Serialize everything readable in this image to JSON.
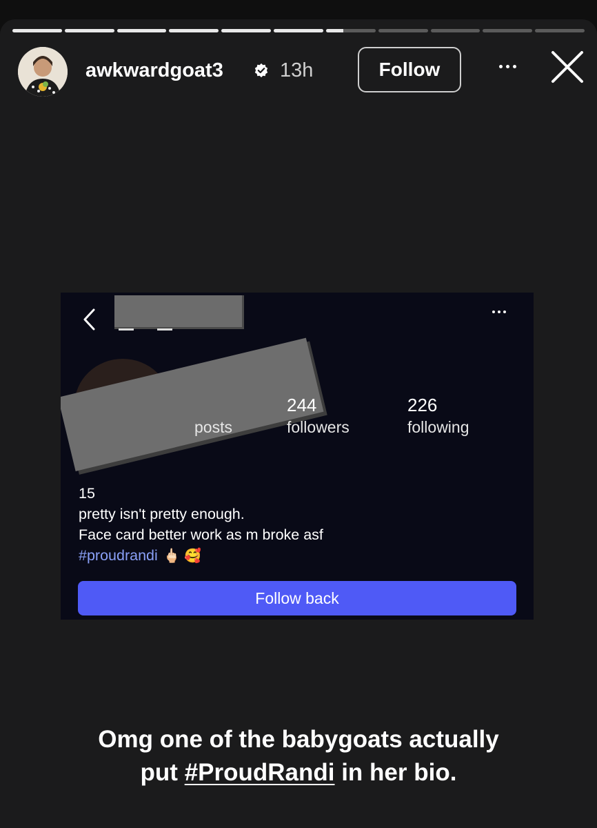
{
  "story": {
    "progress_segments": [
      1,
      1,
      1,
      1,
      1,
      1,
      0.35,
      0,
      0,
      0,
      0
    ],
    "username": "awkwardgoat3",
    "verified": true,
    "time_ago": "13h",
    "follow_label": "Follow",
    "more_icon": "more-horizontal-icon",
    "close_icon": "close-icon"
  },
  "embedded_screenshot": {
    "stats": [
      {
        "num": "",
        "label": "posts"
      },
      {
        "num": "244",
        "label": "followers"
      },
      {
        "num": "226",
        "label": "following"
      }
    ],
    "bio_line1": "15",
    "bio_line2": "pretty isn't pretty enough.",
    "bio_line3": "Face card better work as m broke asf",
    "bio_hashtag": "#proudrandi",
    "bio_emojis": "🖕🏻 🥰",
    "follow_back_label": "Follow back",
    "colors": {
      "background": "#090a17",
      "button": "#4f5af6",
      "hashtag": "#8aa0f7"
    }
  },
  "caption": {
    "part1": "Omg one of the babygoats actually",
    "part2_pre": "put ",
    "part2_link": "#ProudRandi",
    "part2_post": " in her bio."
  }
}
